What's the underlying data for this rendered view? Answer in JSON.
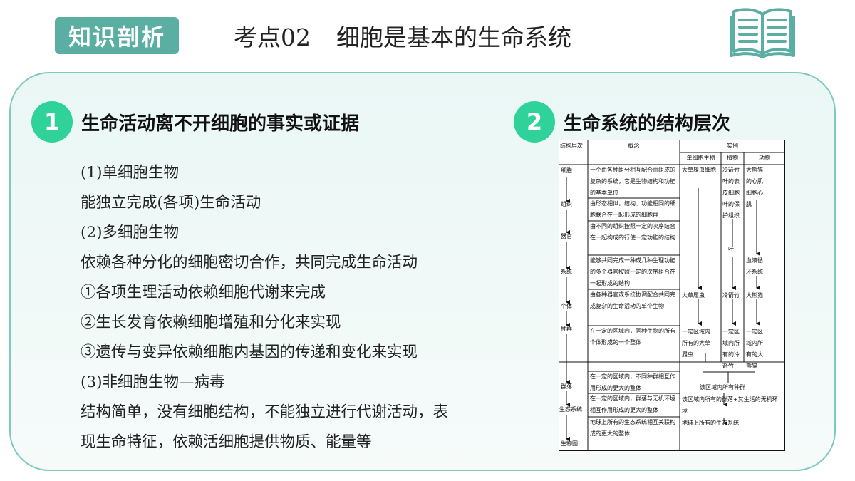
{
  "header": {
    "tag": "知识剖析",
    "title_code": "考点02",
    "title_text": "细胞是基本的生命系统",
    "icon": "book-icon"
  },
  "section1": {
    "number": "1",
    "title": "生命活动离不开细胞的事实或证据",
    "lines": [
      "(1)单细胞生物",
      "能独立完成(各项)生命活动",
      "(2)多细胞生物",
      "依赖各种分化的细胞密切合作，共同完成生命活动",
      "①各项生理活动依赖细胞代谢来完成",
      "②生长发育依赖细胞增殖和分化来实现",
      "③遗传与变异依赖细胞内基因的传递和变化来实现",
      "(3)非细胞生物—病毒",
      "结构简单，没有细胞结构，不能独立进行代谢活动，表",
      "现生命特征，依赖活细胞提供物质、能量等"
    ]
  },
  "section2": {
    "number": "2",
    "title": "生命系统的结构层次",
    "table": {
      "col_level": "结构层次",
      "col_concept": "概念",
      "col_example": "实例",
      "sub_single": "单细胞生物",
      "sub_plant": "植物",
      "sub_animal": "动物",
      "levels": [
        "细胞",
        "组织",
        "器官",
        "系统",
        "个体",
        "种群",
        "群落",
        "生态系统",
        "生物圈"
      ],
      "concepts": [
        "一个由各种组分相互配合而组成的复杂的系统，它是生物结构和功能的基本单位",
        "由形态相似，结构、功能相同的细胞联合在一起形成的细胞群",
        "由不同的组织按照一定的次序结合在一起构成的行使一定功能的结构",
        "能够共同完成一种或几种生理功能的多个器官按照一定的次序组合在一起形成的结构",
        "由各种器官或系统协调配合共同完成复杂的生命活动的单个生物",
        "在一定的区域内，同种生物的所有个体形成的一个整体",
        "在一定的区域内，不同种群相互作用形成的更大的整体",
        "在一定的区域内，群落与无机环境相互作用形成的更大的整体",
        "地球上所有的生态系统相互关联构成的更大的整体"
      ],
      "ex_single_top": "大草履虫细胞",
      "ex_plant_top": "冷箭竹叶的表皮细胞叶的保护组织",
      "ex_plant_organ": "叶",
      "ex_animal_top": "大熊猫的心肌细胞心肌",
      "ex_animal_system": "血液循环系统",
      "ex_single_ind": "大草履虫",
      "ex_plant_ind": "冷箭竹",
      "ex_animal_ind": "大熊猫",
      "ex_single_pop": "一定区域内所有的大草履虫",
      "ex_plant_pop": "一定区域内所有的冷箭竹",
      "ex_animal_pop": "一定区域内所有的大熊猫",
      "ex_community": "该区域内所有种群",
      "ex_ecosystem": "该区域内所有的群落+其生活的无机环境",
      "ex_biosphere": "地球上所有的生态系统"
    }
  }
}
